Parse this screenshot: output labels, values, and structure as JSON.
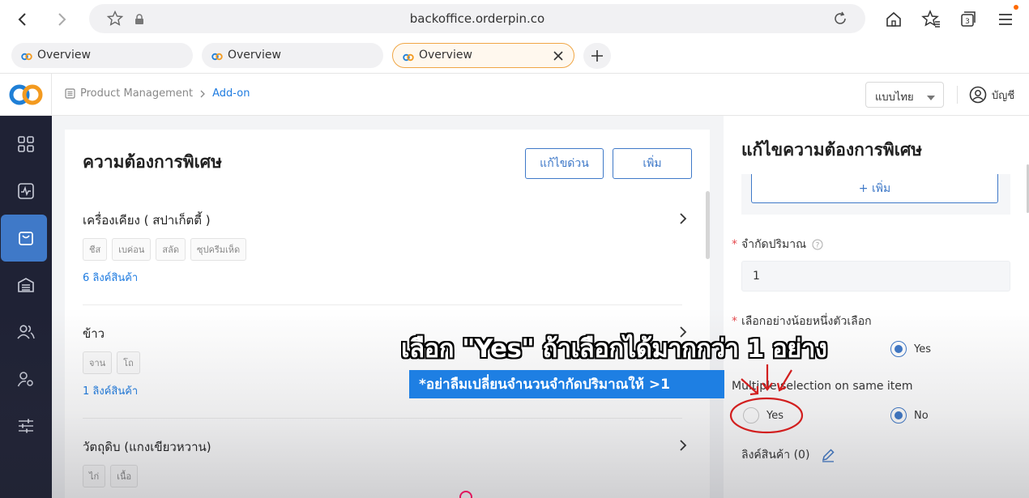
{
  "browser": {
    "url": "backoffice.orderpin.co",
    "tabs": [
      {
        "label": "Overview"
      },
      {
        "label": "Overview"
      },
      {
        "label": "Overview",
        "active": true
      }
    ],
    "tab_count": "3"
  },
  "header": {
    "breadcrumb": {
      "parent": "Product Management",
      "current": "Add-on"
    },
    "language": "แบบไทย",
    "account": "บัญชี"
  },
  "sidebar": {
    "items": [
      {
        "icon": "dashboard-grid-icon"
      },
      {
        "icon": "activity-icon"
      },
      {
        "icon": "shopping-bag-icon",
        "active": true
      },
      {
        "icon": "warehouse-icon"
      },
      {
        "icon": "users-icon"
      },
      {
        "icon": "user-settings-icon"
      },
      {
        "icon": "sliders-icon"
      }
    ]
  },
  "main": {
    "title": "ความต้องการพิเศษ",
    "quick_edit_label": "แก้ไขด่วน",
    "add_label": "เพิ่ม",
    "groups": [
      {
        "title": "เครื่องเคียง ( สปาเก็ตตี้ )",
        "chips": [
          "ชีส",
          "เบค่อน",
          "สลัด",
          "ซุปครีมเห็ด"
        ],
        "link": "6 ลิงค์สินค้า"
      },
      {
        "title": "ข้าว",
        "chips": [
          "จาน",
          "โถ"
        ],
        "link": "1 ลิงค์สินค้า"
      },
      {
        "title": "วัตถุดิบ (แกงเขียวหวาน)",
        "chips": [
          "ไก่",
          "เนื้อ"
        ],
        "link": ""
      }
    ]
  },
  "drawer": {
    "title": "แก้ไขความต้องการพิเศษ",
    "add_option_label": "+ เพิ่ม",
    "limit_label": "จำกัดปริมาณ",
    "limit_value": "1",
    "min_one_label": "เลือกอย่างน้อยหนึ่งตัวเลือก",
    "min_one_yes": "Yes",
    "multiple_label": "Multiple selection on same item",
    "multiple_yes": "Yes",
    "multiple_no": "No",
    "linked_label": "ลิงค์สินค้า (0)"
  },
  "overlay": {
    "caption": "เลือก \"Yes\" ถ้าเลือกได้มากกว่า 1 อย่าง",
    "subcaption": "*อย่าลืมเปลี่ยนจำนวนจำกัดปริมาณให้ >1"
  },
  "colors": {
    "accent": "#3f79c8",
    "sidebar_bg": "#1f2235",
    "link": "#1e7be0",
    "required": "#e5484d",
    "annotation": "#d21f1f",
    "caption_bg": "#1e7fe3"
  }
}
